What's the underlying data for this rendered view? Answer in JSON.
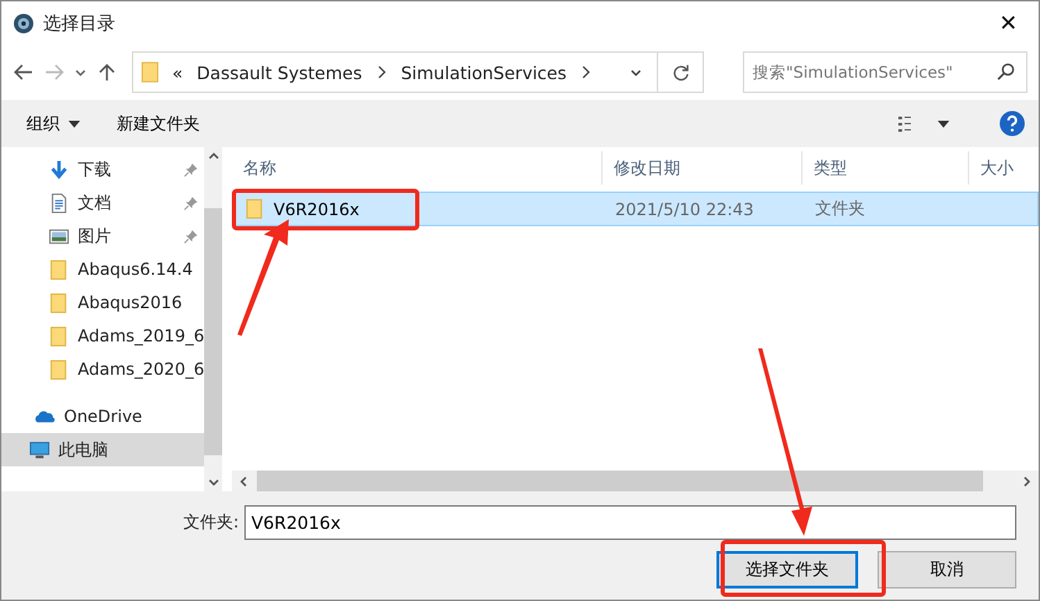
{
  "window": {
    "title": "选择目录",
    "close": "✕"
  },
  "nav": {
    "breadcrumb_prefix": "«",
    "path": [
      "Dassault Systemes",
      "SimulationServices"
    ],
    "search": {
      "placeholder": "搜索\"SimulationServices\""
    }
  },
  "toolbar": {
    "organize": "组织",
    "new_folder": "新建文件夹"
  },
  "sidebar": {
    "items": [
      {
        "kind": "download",
        "label": "下载",
        "pinned": true,
        "selected": false
      },
      {
        "kind": "document",
        "label": "文档",
        "pinned": true,
        "selected": false
      },
      {
        "kind": "image",
        "label": "图片",
        "pinned": true,
        "selected": false
      },
      {
        "kind": "folder",
        "label": "Abaqus6.14.4",
        "pinned": false,
        "selected": false
      },
      {
        "kind": "folder",
        "label": "Abaqus2016",
        "pinned": false,
        "selected": false
      },
      {
        "kind": "folder",
        "label": "Adams_2019_6",
        "pinned": false,
        "selected": false
      },
      {
        "kind": "folder",
        "label": "Adams_2020_6",
        "pinned": false,
        "selected": false
      },
      {
        "kind": "cloud",
        "label": "OneDrive",
        "pinned": false,
        "selected": false
      },
      {
        "kind": "computer",
        "label": "此电脑",
        "pinned": false,
        "selected": true
      }
    ]
  },
  "table": {
    "columns": [
      "名称",
      "修改日期",
      "类型",
      "大小"
    ],
    "rows": [
      {
        "name": "V6R2016x",
        "modified": "2021/5/10 22:43",
        "type": "文件夹",
        "selected": true
      }
    ]
  },
  "folder_field": {
    "label": "文件夹:",
    "value": "V6R2016x"
  },
  "buttons": [
    {
      "label": "选择文件夹",
      "default": true
    },
    {
      "label": "取消",
      "default": false
    }
  ]
}
